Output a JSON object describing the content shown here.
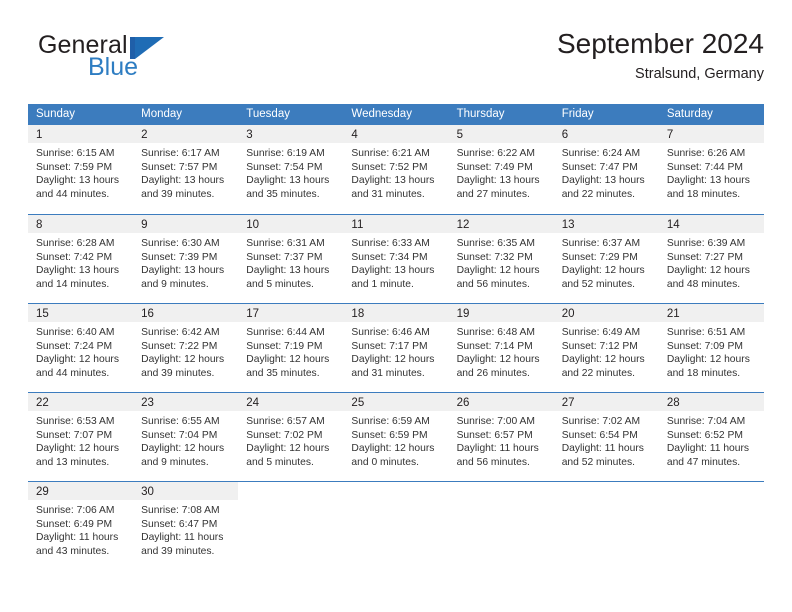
{
  "brand": {
    "name_part1": "General",
    "name_part2": "Blue",
    "flag_icon": "triangle-flag-icon"
  },
  "header": {
    "title": "September 2024",
    "location": "Stralsund, Germany"
  },
  "calendar": {
    "day_headers": [
      "Sunday",
      "Monday",
      "Tuesday",
      "Wednesday",
      "Thursday",
      "Friday",
      "Saturday"
    ],
    "colors": {
      "header_blue": "#3c7cbe",
      "brand_blue": "#2e7dc2",
      "day_band_gray": "#f0f0f0",
      "text": "#231f20"
    },
    "weeks": [
      [
        {
          "day": "1",
          "sunrise": "Sunrise: 6:15 AM",
          "sunset": "Sunset: 7:59 PM",
          "daylight_1": "Daylight: 13 hours",
          "daylight_2": "and 44 minutes."
        },
        {
          "day": "2",
          "sunrise": "Sunrise: 6:17 AM",
          "sunset": "Sunset: 7:57 PM",
          "daylight_1": "Daylight: 13 hours",
          "daylight_2": "and 39 minutes."
        },
        {
          "day": "3",
          "sunrise": "Sunrise: 6:19 AM",
          "sunset": "Sunset: 7:54 PM",
          "daylight_1": "Daylight: 13 hours",
          "daylight_2": "and 35 minutes."
        },
        {
          "day": "4",
          "sunrise": "Sunrise: 6:21 AM",
          "sunset": "Sunset: 7:52 PM",
          "daylight_1": "Daylight: 13 hours",
          "daylight_2": "and 31 minutes."
        },
        {
          "day": "5",
          "sunrise": "Sunrise: 6:22 AM",
          "sunset": "Sunset: 7:49 PM",
          "daylight_1": "Daylight: 13 hours",
          "daylight_2": "and 27 minutes."
        },
        {
          "day": "6",
          "sunrise": "Sunrise: 6:24 AM",
          "sunset": "Sunset: 7:47 PM",
          "daylight_1": "Daylight: 13 hours",
          "daylight_2": "and 22 minutes."
        },
        {
          "day": "7",
          "sunrise": "Sunrise: 6:26 AM",
          "sunset": "Sunset: 7:44 PM",
          "daylight_1": "Daylight: 13 hours",
          "daylight_2": "and 18 minutes."
        }
      ],
      [
        {
          "day": "8",
          "sunrise": "Sunrise: 6:28 AM",
          "sunset": "Sunset: 7:42 PM",
          "daylight_1": "Daylight: 13 hours",
          "daylight_2": "and 14 minutes."
        },
        {
          "day": "9",
          "sunrise": "Sunrise: 6:30 AM",
          "sunset": "Sunset: 7:39 PM",
          "daylight_1": "Daylight: 13 hours",
          "daylight_2": "and 9 minutes."
        },
        {
          "day": "10",
          "sunrise": "Sunrise: 6:31 AM",
          "sunset": "Sunset: 7:37 PM",
          "daylight_1": "Daylight: 13 hours",
          "daylight_2": "and 5 minutes."
        },
        {
          "day": "11",
          "sunrise": "Sunrise: 6:33 AM",
          "sunset": "Sunset: 7:34 PM",
          "daylight_1": "Daylight: 13 hours",
          "daylight_2": "and 1 minute."
        },
        {
          "day": "12",
          "sunrise": "Sunrise: 6:35 AM",
          "sunset": "Sunset: 7:32 PM",
          "daylight_1": "Daylight: 12 hours",
          "daylight_2": "and 56 minutes."
        },
        {
          "day": "13",
          "sunrise": "Sunrise: 6:37 AM",
          "sunset": "Sunset: 7:29 PM",
          "daylight_1": "Daylight: 12 hours",
          "daylight_2": "and 52 minutes."
        },
        {
          "day": "14",
          "sunrise": "Sunrise: 6:39 AM",
          "sunset": "Sunset: 7:27 PM",
          "daylight_1": "Daylight: 12 hours",
          "daylight_2": "and 48 minutes."
        }
      ],
      [
        {
          "day": "15",
          "sunrise": "Sunrise: 6:40 AM",
          "sunset": "Sunset: 7:24 PM",
          "daylight_1": "Daylight: 12 hours",
          "daylight_2": "and 44 minutes."
        },
        {
          "day": "16",
          "sunrise": "Sunrise: 6:42 AM",
          "sunset": "Sunset: 7:22 PM",
          "daylight_1": "Daylight: 12 hours",
          "daylight_2": "and 39 minutes."
        },
        {
          "day": "17",
          "sunrise": "Sunrise: 6:44 AM",
          "sunset": "Sunset: 7:19 PM",
          "daylight_1": "Daylight: 12 hours",
          "daylight_2": "and 35 minutes."
        },
        {
          "day": "18",
          "sunrise": "Sunrise: 6:46 AM",
          "sunset": "Sunset: 7:17 PM",
          "daylight_1": "Daylight: 12 hours",
          "daylight_2": "and 31 minutes."
        },
        {
          "day": "19",
          "sunrise": "Sunrise: 6:48 AM",
          "sunset": "Sunset: 7:14 PM",
          "daylight_1": "Daylight: 12 hours",
          "daylight_2": "and 26 minutes."
        },
        {
          "day": "20",
          "sunrise": "Sunrise: 6:49 AM",
          "sunset": "Sunset: 7:12 PM",
          "daylight_1": "Daylight: 12 hours",
          "daylight_2": "and 22 minutes."
        },
        {
          "day": "21",
          "sunrise": "Sunrise: 6:51 AM",
          "sunset": "Sunset: 7:09 PM",
          "daylight_1": "Daylight: 12 hours",
          "daylight_2": "and 18 minutes."
        }
      ],
      [
        {
          "day": "22",
          "sunrise": "Sunrise: 6:53 AM",
          "sunset": "Sunset: 7:07 PM",
          "daylight_1": "Daylight: 12 hours",
          "daylight_2": "and 13 minutes."
        },
        {
          "day": "23",
          "sunrise": "Sunrise: 6:55 AM",
          "sunset": "Sunset: 7:04 PM",
          "daylight_1": "Daylight: 12 hours",
          "daylight_2": "and 9 minutes."
        },
        {
          "day": "24",
          "sunrise": "Sunrise: 6:57 AM",
          "sunset": "Sunset: 7:02 PM",
          "daylight_1": "Daylight: 12 hours",
          "daylight_2": "and 5 minutes."
        },
        {
          "day": "25",
          "sunrise": "Sunrise: 6:59 AM",
          "sunset": "Sunset: 6:59 PM",
          "daylight_1": "Daylight: 12 hours",
          "daylight_2": "and 0 minutes."
        },
        {
          "day": "26",
          "sunrise": "Sunrise: 7:00 AM",
          "sunset": "Sunset: 6:57 PM",
          "daylight_1": "Daylight: 11 hours",
          "daylight_2": "and 56 minutes."
        },
        {
          "day": "27",
          "sunrise": "Sunrise: 7:02 AM",
          "sunset": "Sunset: 6:54 PM",
          "daylight_1": "Daylight: 11 hours",
          "daylight_2": "and 52 minutes."
        },
        {
          "day": "28",
          "sunrise": "Sunrise: 7:04 AM",
          "sunset": "Sunset: 6:52 PM",
          "daylight_1": "Daylight: 11 hours",
          "daylight_2": "and 47 minutes."
        }
      ],
      [
        {
          "day": "29",
          "sunrise": "Sunrise: 7:06 AM",
          "sunset": "Sunset: 6:49 PM",
          "daylight_1": "Daylight: 11 hours",
          "daylight_2": "and 43 minutes."
        },
        {
          "day": "30",
          "sunrise": "Sunrise: 7:08 AM",
          "sunset": "Sunset: 6:47 PM",
          "daylight_1": "Daylight: 11 hours",
          "daylight_2": "and 39 minutes."
        },
        {
          "day": "",
          "sunrise": "",
          "sunset": "",
          "daylight_1": "",
          "daylight_2": ""
        },
        {
          "day": "",
          "sunrise": "",
          "sunset": "",
          "daylight_1": "",
          "daylight_2": ""
        },
        {
          "day": "",
          "sunrise": "",
          "sunset": "",
          "daylight_1": "",
          "daylight_2": ""
        },
        {
          "day": "",
          "sunrise": "",
          "sunset": "",
          "daylight_1": "",
          "daylight_2": ""
        },
        {
          "day": "",
          "sunrise": "",
          "sunset": "",
          "daylight_1": "",
          "daylight_2": ""
        }
      ]
    ]
  }
}
